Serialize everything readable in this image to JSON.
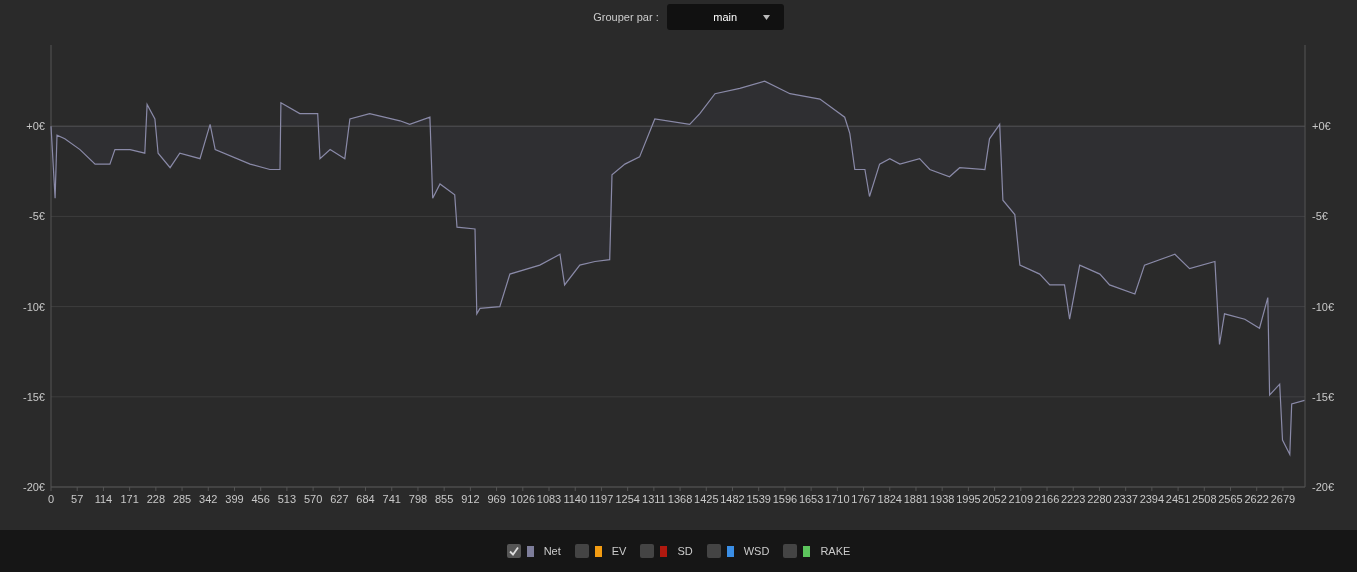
{
  "header": {
    "label": "Grouper par :",
    "dropdown": {
      "value": "main"
    }
  },
  "chart": {
    "right_axis_labels": [
      "+0€",
      "-5€",
      "-10€",
      "-15€",
      "-20€"
    ],
    "chart_data": {
      "type": "line",
      "grid": true,
      "xlim": [
        0,
        2727
      ],
      "ylim": [
        -20,
        4.5
      ],
      "xticks": [
        0,
        57,
        114,
        171,
        228,
        285,
        342,
        399,
        456,
        513,
        570,
        627,
        684,
        741,
        798,
        855,
        912,
        969,
        1026,
        1083,
        1140,
        1197,
        1254,
        1311,
        1368,
        1425,
        1482,
        1539,
        1596,
        1653,
        1710,
        1767,
        1824,
        1881,
        1938,
        1995,
        2052,
        2109,
        2166,
        2223,
        2280,
        2337,
        2394,
        2451,
        2508,
        2565,
        2622,
        2679
      ],
      "yticks": [
        {
          "value": 0,
          "label": "+0€"
        },
        {
          "value": -5,
          "label": "-5€"
        },
        {
          "value": -10,
          "label": "-10€"
        },
        {
          "value": -15,
          "label": "-15€"
        },
        {
          "value": -20,
          "label": "-20€"
        }
      ],
      "x": [
        0,
        9,
        13,
        30,
        63,
        96,
        128,
        139,
        172,
        204,
        209,
        226,
        233,
        259,
        280,
        324,
        346,
        357,
        433,
        476,
        498,
        500,
        541,
        580,
        585,
        607,
        639,
        650,
        693,
        759,
        780,
        824,
        830,
        846,
        878,
        883,
        922,
        926,
        933,
        976,
        998,
        1063,
        1107,
        1117,
        1150,
        1183,
        1215,
        1220,
        1248,
        1280,
        1313,
        1389,
        1411,
        1444,
        1498,
        1552,
        1607,
        1672,
        1726,
        1737,
        1748,
        1770,
        1780,
        1802,
        1824,
        1846,
        1889,
        1911,
        1954,
        1976,
        2031,
        2041,
        2063,
        2070,
        2096,
        2107,
        2150,
        2172,
        2204,
        2215,
        2237,
        2281,
        2302,
        2357,
        2378,
        2444,
        2476,
        2531,
        2541,
        2552,
        2596,
        2628,
        2646,
        2650,
        2672,
        2678,
        2694,
        2698,
        2726
      ],
      "series": [
        {
          "color": "#8a8aa8",
          "values": [
            0,
            -4,
            -0.5,
            -0.7,
            -1.3,
            -2.1,
            -2.1,
            -1.3,
            -1.3,
            -1.5,
            1.2,
            0.4,
            -1.5,
            -2.3,
            -1.5,
            -1.8,
            0.1,
            -1.3,
            -2.1,
            -2.4,
            -2.4,
            1.3,
            0.7,
            0.7,
            -1.8,
            -1.3,
            -1.8,
            0.4,
            0.7,
            0.3,
            0.1,
            0.5,
            -4,
            -3.2,
            -3.8,
            -5.6,
            -5.7,
            -10.4,
            -10.1,
            -10,
            -8.2,
            -7.7,
            -7.1,
            -8.8,
            -7.7,
            -7.5,
            -7.4,
            -2.7,
            -2.1,
            -1.7,
            0.4,
            0.1,
            0.7,
            1.8,
            2.1,
            2.5,
            1.8,
            1.5,
            0.5,
            -0.4,
            -2.4,
            -2.4,
            -3.9,
            -2.1,
            -1.8,
            -2.1,
            -1.8,
            -2.4,
            -2.8,
            -2.3,
            -2.4,
            -0.7,
            0.1,
            -4.1,
            -4.9,
            -7.7,
            -8.2,
            -8.8,
            -8.8,
            -10.7,
            -7.7,
            -8.2,
            -8.8,
            -9.3,
            -7.7,
            -7.1,
            -7.9,
            -7.5,
            -12.1,
            -10.4,
            -10.7,
            -11.2,
            -9.5,
            -14.9,
            -14.3,
            -17.4,
            -18.2,
            -15.4,
            -15.2
          ]
        }
      ]
    }
  },
  "legend": [
    {
      "label": "Net",
      "checked": true,
      "color": "#7d7d9a"
    },
    {
      "label": "EV",
      "checked": false,
      "color": "#f39c12"
    },
    {
      "label": "SD",
      "checked": false,
      "color": "#b0190f"
    },
    {
      "label": "WSD",
      "checked": false,
      "color": "#3a8ee6"
    },
    {
      "label": "RAKE",
      "checked": false,
      "color": "#5cc45c"
    }
  ]
}
